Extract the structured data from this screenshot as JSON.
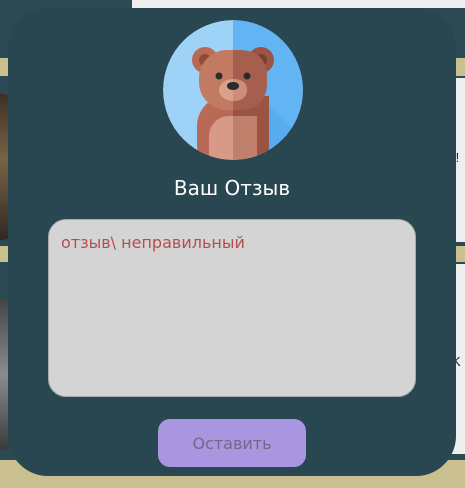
{
  "background": {
    "side_text_1": "!!",
    "side_text_2": "K"
  },
  "modal": {
    "avatar_icon": "bear-avatar",
    "title": "Ваш Отзыв",
    "review_field": {
      "value": "отзыв\\ неправильный",
      "placeholder": ""
    },
    "submit_label": "Оставить"
  },
  "colors": {
    "modal_background": "#294751",
    "field_background": "#d4d4d4",
    "field_text": "#b54e4e",
    "button_background": "#a995e0",
    "button_text": "#6f6a86",
    "page_background": "#c9bf8f"
  }
}
